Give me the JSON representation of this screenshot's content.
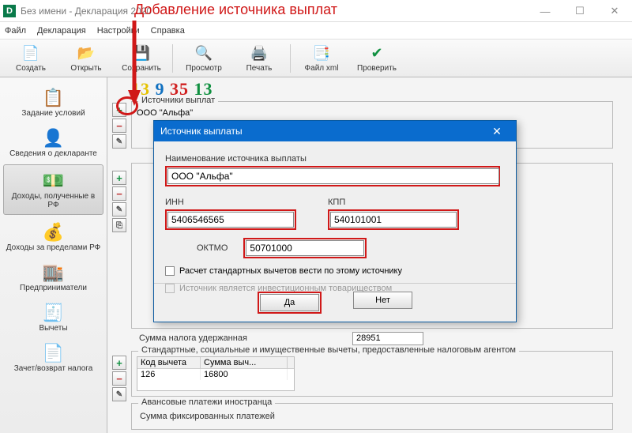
{
  "annotation": {
    "title": "Добавление источника выплат"
  },
  "window": {
    "title": "Без имени - Декларация 2020",
    "app_icon_letter": "D"
  },
  "menu": {
    "file": "Файл",
    "declaration": "Декларация",
    "settings": "Настройки",
    "help": "Справка"
  },
  "toolbar": {
    "create": "Создать",
    "open": "Открыть",
    "save": "Сохранить",
    "preview": "Просмотр",
    "print": "Печать",
    "xml": "Файл xml",
    "check": "Проверить"
  },
  "sidebar": {
    "conditions": "Задание условий",
    "declarant": "Сведения о декларанте",
    "income_rf": "Доходы, полученные в РФ",
    "income_abroad": "Доходы за пределами РФ",
    "entrepreneur": "Предприниматели",
    "deductions": "Вычеты",
    "offset": "Зачет/возврат налога"
  },
  "content": {
    "big_numbers": {
      "n1": "13",
      "n2": "9",
      "n3": "35",
      "n4": "13"
    },
    "sources_label": "Источники выплат",
    "source_row": "ООО \"Альфа\"",
    "tax_withheld_label": "Сумма налога удержанная",
    "tax_withheld_value": "28951",
    "deductions_title": "Стандартные, социальные и имущественные вычеты, предоставленные налоговым агентом",
    "col_code": "Код вычета",
    "col_sum": "Сумма выч...",
    "ded_code": "126",
    "ded_sum": "16800",
    "advance_title": "Авансовые платежи иностранца",
    "advance_label": "Сумма фиксированных платежей"
  },
  "dialog": {
    "title": "Источник выплаты",
    "name_label": "Наименование источника выплаты",
    "name_value": "ООО \"Альфа\"",
    "inn_label": "ИНН",
    "inn_value": "5406546565",
    "kpp_label": "КПП",
    "kpp_value": "540101001",
    "oktmo_label": "ОКТМО",
    "oktmo_value": "50701000",
    "cb1": "Расчет стандартных вычетов вести по этому источнику",
    "cb2": "Источник является инвестиционным товариществом",
    "yes": "Да",
    "no": "Нет"
  }
}
